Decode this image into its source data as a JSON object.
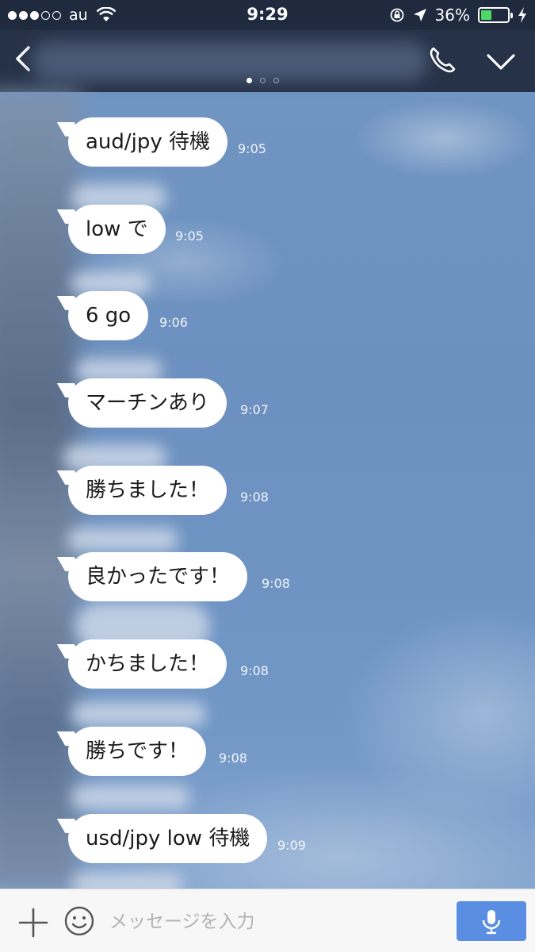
{
  "status_bar": {
    "carrier": "au",
    "time": "9:29",
    "battery_percent": "36%",
    "battery_level": 0.36
  },
  "nav": {
    "contact_name": "",
    "page_indicator": {
      "count": 3,
      "active": 0
    }
  },
  "messages": [
    {
      "text": "aud/jpy 待機",
      "time": "9:05"
    },
    {
      "text": "low で",
      "time": "9:05"
    },
    {
      "text": "6 go",
      "time": "9:06"
    },
    {
      "text": "マーチンあり",
      "time": "9:07"
    },
    {
      "text": "勝ちました！",
      "time": "9:08"
    },
    {
      "text": "良かったです！",
      "time": "9:08"
    },
    {
      "text": "かちました！",
      "time": "9:08"
    },
    {
      "text": "勝ちです！",
      "time": "9:08"
    },
    {
      "text": "usd/jpy low 待機",
      "time": "9:09"
    }
  ],
  "input_bar": {
    "placeholder": "メッセージを入力",
    "value": ""
  },
  "colors": {
    "status_bar_bg": "#1f2a3f",
    "nav_bg": "#263248",
    "chat_bg": "#6e93c2",
    "bubble": "#ffffff",
    "mic_button": "#5a8ee2",
    "battery_fill": "#4cd964"
  },
  "icons": [
    "back-arrow-icon",
    "phone-icon",
    "chevron-down-icon",
    "plus-icon",
    "emoji-icon",
    "microphone-icon",
    "wifi-icon",
    "orientation-lock-icon",
    "location-arrow-icon",
    "charging-bolt-icon"
  ]
}
